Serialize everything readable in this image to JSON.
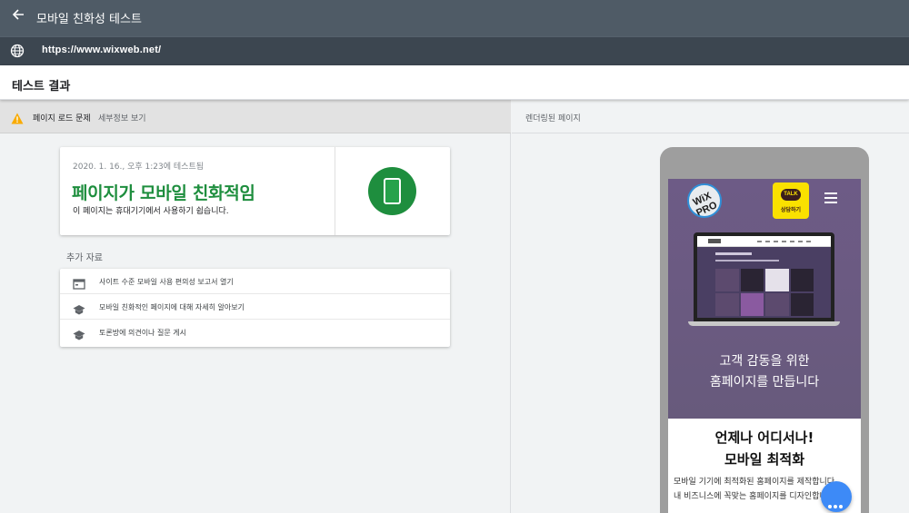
{
  "app": {
    "title": "모바일 친화성 테스트"
  },
  "url_bar": {
    "url": "https://www.wixweb.net/"
  },
  "results": {
    "title": "테스트 결과"
  },
  "issue_bar": {
    "text": "페이지 로드 문제",
    "link": "세부정보 보기",
    "icon": "warning-icon",
    "icon_color": "#f9ab00"
  },
  "result_card": {
    "date": "2020. 1. 16., 오후 1:23에 테스트됨",
    "headline": "페이지가 모바일 친화적임",
    "description": "이 페이지는 휴대기기에서 사용하기 쉽습니다.",
    "accent_color": "#1e8e3e"
  },
  "extra_resources": {
    "title": "추가 자료",
    "items": [
      {
        "label": "사이트 수준 모바일 사용 편의성 보고서 열기",
        "icon": "report-icon"
      },
      {
        "label": "모바일 친화적인 페이지에 대해 자세히 알아보기",
        "icon": "school-icon"
      },
      {
        "label": "토론방에 의견이나 질문 게시",
        "icon": "school-icon"
      }
    ]
  },
  "rendered": {
    "title": "렌더링된 페이지",
    "site": {
      "logo_text": "WiX PRO",
      "talk_badge": "TALK",
      "talk_label": "상담하기",
      "laptop_heading": "CELEBRITY",
      "hero_line1": "고객 감동을 위한",
      "hero_line2": "홈페이지를 만듭니다",
      "section_line1": "언제나 어디서나!",
      "section_line2": "모바일 최적화",
      "body_line1": "모바일 기기에 최적화된 홈페이지를 제작합니다.",
      "body_line2": "내 비즈니스에 꼭맞는 홈페이지를 디자인합니다."
    }
  }
}
